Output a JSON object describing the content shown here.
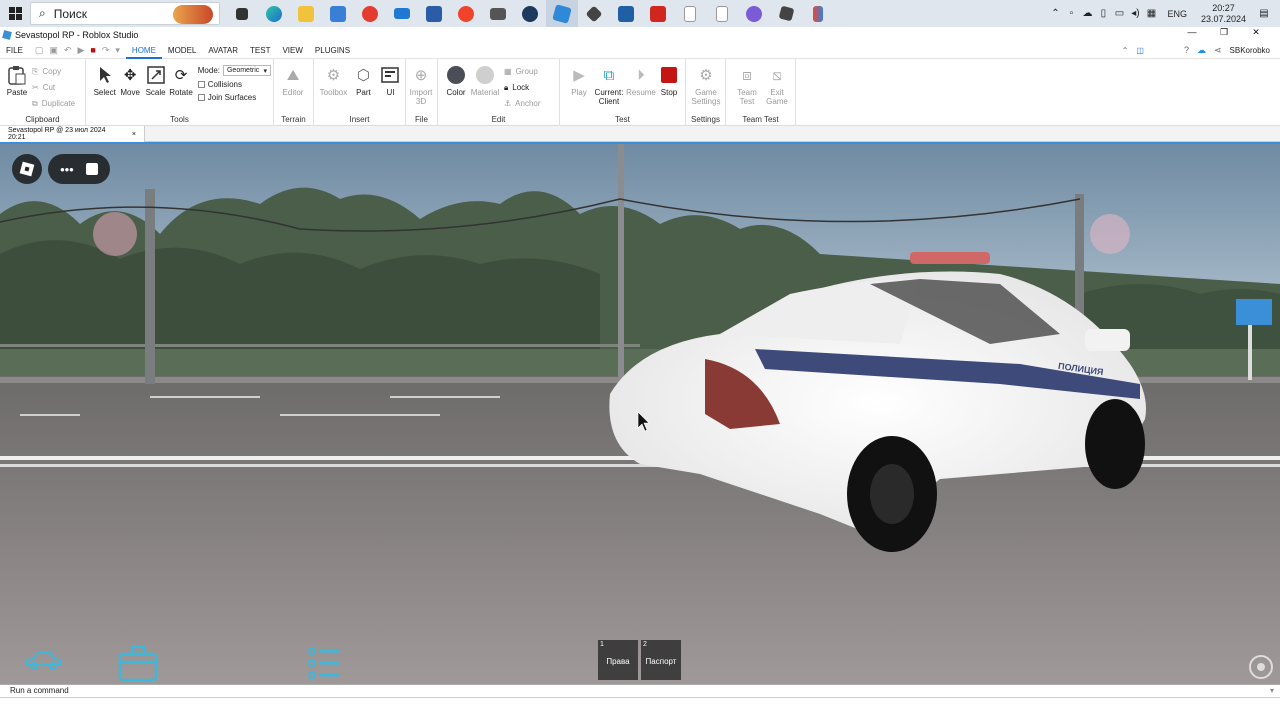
{
  "taskbar": {
    "search_placeholder": "Поиск",
    "icons": [
      "start-icon",
      "task-view-icon",
      "edge-icon",
      "file-explorer-icon",
      "store-icon",
      "yandex-browser-icon",
      "mail-icon",
      "word-icon",
      "yandex-icon",
      "camera-icon",
      "steam-icon",
      "roblox-studio-icon",
      "app-icon",
      "screen-capture-icon",
      "pdf-icon",
      "document-icon",
      "document-icon-2",
      "discord-icon",
      "roblox-icon",
      "roblox-player-icon"
    ],
    "tray": {
      "lang": "ENG",
      "time": "20:27",
      "date": "23.07.2024"
    }
  },
  "window": {
    "title": "Sevastopol RP - Roblox Studio"
  },
  "menu": {
    "file": "FILE",
    "tabs": [
      "HOME",
      "MODEL",
      "AVATAR",
      "TEST",
      "VIEW",
      "PLUGINS"
    ],
    "active_tab": "HOME",
    "user": "SBKorobko"
  },
  "ribbon": {
    "clipboard": {
      "label": "Clipboard",
      "paste": "Paste",
      "copy": "Copy",
      "cut": "Cut",
      "duplicate": "Duplicate"
    },
    "tools": {
      "label": "Tools",
      "select": "Select",
      "move": "Move",
      "scale": "Scale",
      "rotate": "Rotate",
      "mode_label": "Mode:",
      "mode_value": "Geometric",
      "collisions": "Collisions",
      "join_surfaces": "Join Surfaces"
    },
    "terrain": {
      "label": "Terrain",
      "editor": "Editor"
    },
    "insert": {
      "label": "Insert",
      "toolbox": "Toolbox",
      "part": "Part",
      "ui": "UI"
    },
    "file": {
      "label": "File",
      "import_line1": "Import",
      "import_line2": "3D"
    },
    "edit": {
      "label": "Edit",
      "color": "Color",
      "material": "Material",
      "group": "Group",
      "lock": "Lock",
      "anchor": "Anchor"
    },
    "test": {
      "label": "Test",
      "play": "Play",
      "current_line1": "Current:",
      "current_line2": "Client",
      "resume": "Resume",
      "stop": "Stop"
    },
    "settings": {
      "label": "Settings",
      "game_line1": "Game",
      "game_line2": "Settings"
    },
    "team_test": {
      "label": "Team Test",
      "team_line1": "Team",
      "team_line2": "Test",
      "exit_line1": "Exit",
      "exit_line2": "Game"
    }
  },
  "doc_tab": {
    "title": "Sevastopol RP @ 23 июл 2024 20:21",
    "close": "×"
  },
  "viewport": {
    "car_door_text": "ПОЛИЦИЯ",
    "hotbar": [
      {
        "num": "1",
        "label": "Права"
      },
      {
        "num": "2",
        "label": "Паспорт"
      }
    ]
  },
  "command_bar": {
    "placeholder": "Run a command"
  },
  "colors": {
    "accent": "#1d6fd8",
    "viewport_border": "#3a8fd8",
    "stop_red": "#c41414",
    "hud_cyan": "#3fb7d9"
  }
}
